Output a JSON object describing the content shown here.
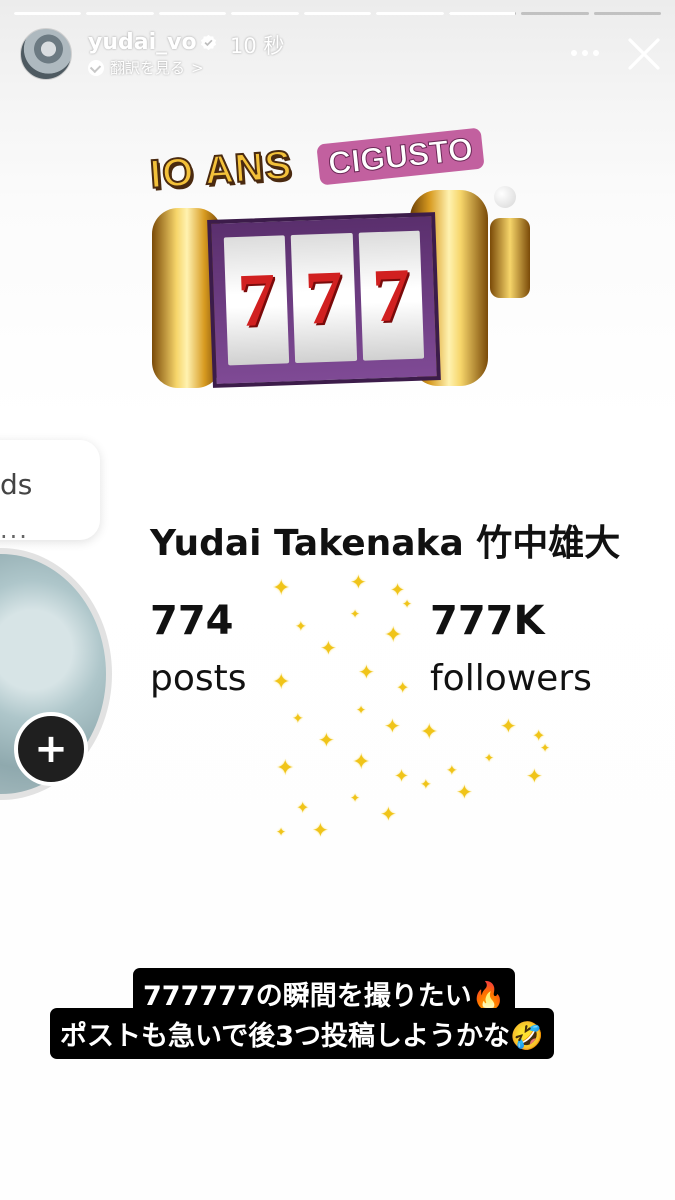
{
  "story": {
    "progress": [
      1,
      1,
      1,
      1,
      1,
      1,
      0.98,
      0,
      0
    ],
    "header": {
      "username": "yudai_vo",
      "time_ago": "10 秒",
      "translate_label": "翻訳を見る",
      "translate_chevron": ">",
      "verified_icon": "verified-badge-icon",
      "more_icon": "more-icon",
      "close_icon": "close-icon"
    }
  },
  "sticker": {
    "title": "IO ANS",
    "brand": "CIGUSTO",
    "reels": [
      "7",
      "7",
      "7"
    ]
  },
  "profile": {
    "partial_label": "ds",
    "partial_more": "...",
    "add_icon": "+",
    "name": "Yudai Takenaka 竹中雄大",
    "posts_count": "774",
    "posts_label": "posts",
    "followers_count": "777K",
    "followers_label": "followers",
    "sparkle_color": "#f0c419"
  },
  "caption": {
    "line1": "777777の瞬間を撮りたい🔥",
    "line2": "ポストも急いで後3つ投稿しようかな🤣"
  }
}
